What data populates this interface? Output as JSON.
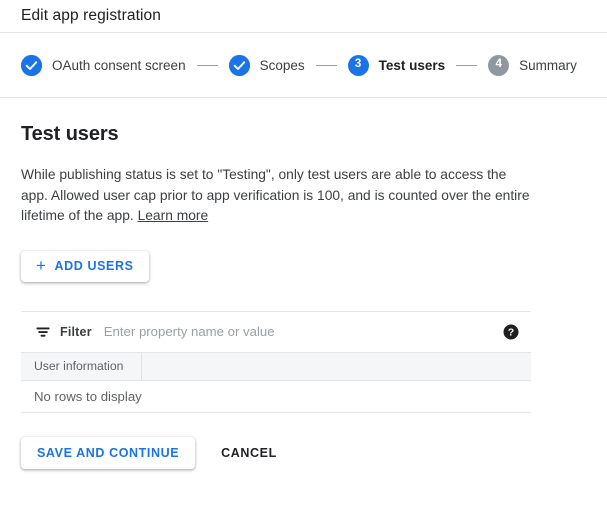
{
  "header": {
    "title": "Edit app registration"
  },
  "stepper": {
    "steps": [
      {
        "label": "OAuth consent screen",
        "state": "done",
        "marker": "check"
      },
      {
        "label": "Scopes",
        "state": "done",
        "marker": "check"
      },
      {
        "label": "Test users",
        "state": "active",
        "marker": "3"
      },
      {
        "label": "Summary",
        "state": "todo",
        "marker": "4"
      }
    ],
    "separator": "—",
    "active_color": "#1a73e8",
    "inactive_color": "#9097a0"
  },
  "main": {
    "section_title": "Test users",
    "description_text": "While publishing status is set to \"Testing\", only test users are able to access the app. Allowed user cap prior to app verification is 100, and is counted over the entire lifetime of the app. ",
    "learn_more_label": "Learn more",
    "add_users_label": "ADD USERS",
    "add_users_plus": "+"
  },
  "table": {
    "filter_label": "Filter",
    "filter_placeholder": "Enter property name or value",
    "filter_value": "",
    "columns": [
      "User information",
      ""
    ],
    "empty_message": "No rows to display",
    "rows": []
  },
  "footer": {
    "save_label": "SAVE AND CONTINUE",
    "cancel_label": "CANCEL"
  },
  "colors": {
    "accent": "#1a73e8",
    "text": "#202124",
    "muted": "#5f6368",
    "placeholder": "#9aa0a6",
    "border": "#e4e6e8",
    "header_bg": "#f5f6f7"
  }
}
